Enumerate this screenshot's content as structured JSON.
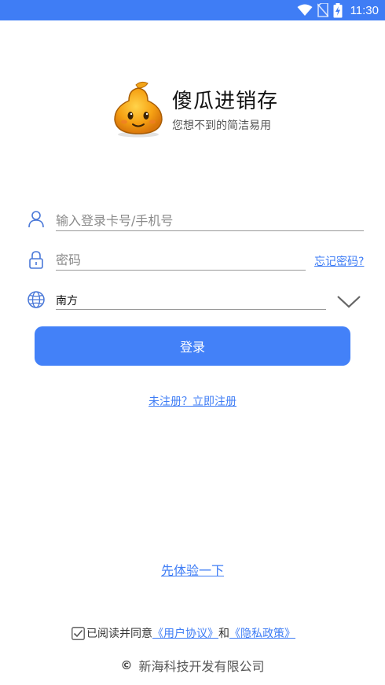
{
  "status_bar": {
    "time": "11:30",
    "icons": [
      "wifi-icon",
      "no-sim-icon",
      "battery-charging-icon"
    ]
  },
  "app": {
    "name": "傻瓜进销存",
    "slogan": "您想不到的简洁易用"
  },
  "login_form": {
    "account_placeholder": "输入登录卡号/手机号",
    "password_placeholder": "密码",
    "forgot_password": "忘记密码?",
    "server_value": "南方",
    "login_button": "登录"
  },
  "links": {
    "register": "未注册？立即注册",
    "trial": "先体验一下"
  },
  "agreement": {
    "checked": true,
    "prefix": "已阅读并同意",
    "user_agreement": "《用户协议》",
    "conjunction": "和",
    "privacy_policy": "《隐私政策》"
  },
  "footer": {
    "copyright_symbol": "©",
    "company": "新海科技开发有限公司"
  },
  "colors": {
    "accent": "#4381f8",
    "status_bar": "#3f7df5",
    "icon": "#4a78d8"
  }
}
